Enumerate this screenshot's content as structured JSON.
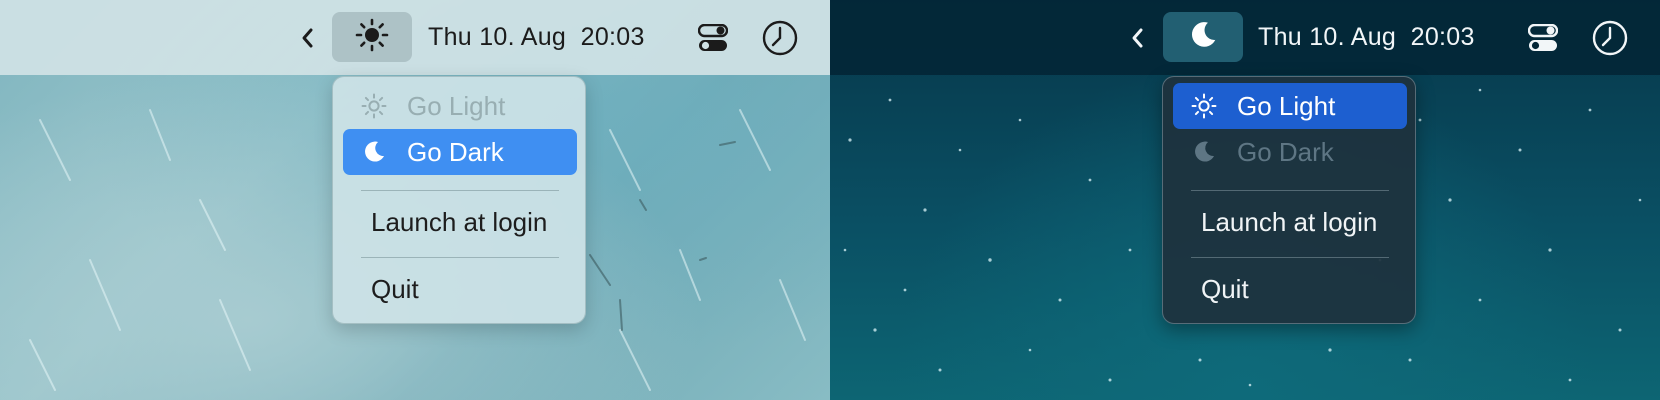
{
  "panels": [
    {
      "theme": "light",
      "menubar": {
        "chevron_icon": "chevron-left-icon",
        "mode_icon": "sun-icon",
        "datetime": "Thu 10. Aug  20:03",
        "control_center_icon": "toggle-switches-icon",
        "clock_icon": "clock-icon"
      },
      "menu": {
        "items": [
          {
            "label": "Go Light",
            "icon": "sun-icon",
            "state": "disabled"
          },
          {
            "label": "Go Dark",
            "icon": "moon-icon",
            "state": "selected"
          },
          {
            "label": "Launch at login",
            "state": "normal"
          },
          {
            "label": "Quit",
            "state": "normal"
          }
        ]
      },
      "colors": {
        "highlight": "#3f8ff2",
        "menubar": "#d0e2e5"
      }
    },
    {
      "theme": "dark",
      "menubar": {
        "chevron_icon": "chevron-left-icon",
        "mode_icon": "moon-icon",
        "datetime": "Thu 10. Aug  20:03",
        "control_center_icon": "toggle-switches-icon",
        "clock_icon": "clock-icon"
      },
      "menu": {
        "items": [
          {
            "label": "Go Light",
            "icon": "sun-icon",
            "state": "selected"
          },
          {
            "label": "Go Dark",
            "icon": "moon-icon",
            "state": "disabled"
          },
          {
            "label": "Launch at login",
            "state": "normal"
          },
          {
            "label": "Quit",
            "state": "normal"
          }
        ]
      },
      "colors": {
        "highlight": "#1d5fd0",
        "menubar": "#032636"
      }
    }
  ]
}
